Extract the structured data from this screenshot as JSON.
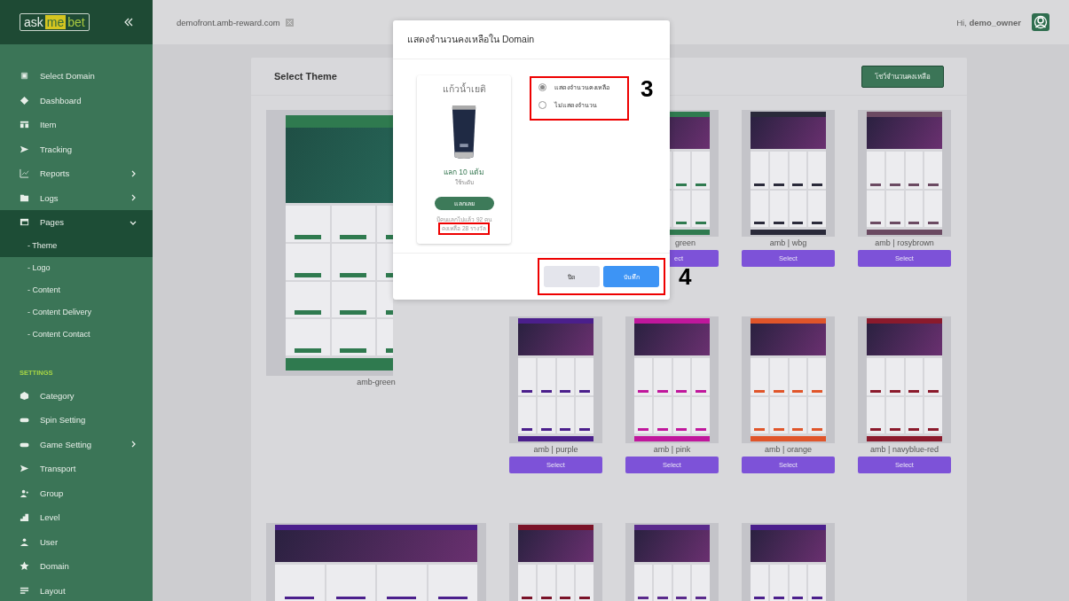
{
  "sidebar": {
    "logo": [
      "ask",
      "me",
      "bet"
    ],
    "sections": [
      {
        "items": [
          {
            "label": "Select Domain",
            "selected": false
          },
          {
            "label": "Dashboard",
            "selected": false
          },
          {
            "label": "Item",
            "selected": false
          },
          {
            "label": "Tracking",
            "selected": false
          },
          {
            "label": "Reports",
            "selected": false,
            "expanded": false
          },
          {
            "label": "Logs",
            "selected": false,
            "expanded": false
          },
          {
            "label": "Pages",
            "selected": false,
            "expanded": true,
            "children": [
              {
                "label": "- Theme",
                "selected": true
              },
              {
                "label": "- Logo",
                "selected": false
              },
              {
                "label": "- Content",
                "selected": false
              },
              {
                "label": "- Content Delivery",
                "selected": false
              },
              {
                "label": "- Content Contact",
                "selected": false
              }
            ]
          }
        ]
      },
      {
        "title": "SETTINGS",
        "items": [
          {
            "label": "Category",
            "selected": false
          },
          {
            "label": "Spin Setting",
            "selected": false
          },
          {
            "label": "Game Setting",
            "selected": false,
            "expanded": false
          },
          {
            "label": "Transport",
            "selected": false
          },
          {
            "label": "Group",
            "selected": false
          },
          {
            "label": "Level",
            "selected": false
          },
          {
            "label": "User",
            "selected": false
          },
          {
            "label": "Domain",
            "selected": false
          },
          {
            "label": "Layout",
            "selected": false
          }
        ]
      }
    ]
  },
  "topbar": {
    "domain": "demofront.amb-reward.com",
    "greeting": "Hi, **demo_owner**"
  },
  "panel": {
    "title": "Select Theme",
    "action": "โชว์จำนวนคงเหลือ",
    "themes": [
      {
        "kind": "large",
        "label": "amb-green",
        "color": "#2f7a4f"
      },
      {
        "kind": "hidden"
      },
      {
        "kind": "partial",
        "label": "green",
        "button": "ect",
        "color": "#2f7a4f"
      },
      {
        "kind": "normal",
        "label": "amb | wbg",
        "button": "Select",
        "color": "#2a2a3a"
      },
      {
        "kind": "normal",
        "label": "amb | rosybrown",
        "button": "Select",
        "color": "#6b4a62"
      },
      {
        "kind": "normal",
        "label": "amb | purple",
        "button": "Select",
        "color": "#4b1f8c"
      },
      {
        "kind": "normal",
        "label": "amb | pink",
        "button": "Select",
        "color": "#c0179c"
      },
      {
        "kind": "normal",
        "label": "amb | orange",
        "button": "Select",
        "color": "#e0552a"
      },
      {
        "kind": "normal",
        "label": "amb | navyblue-red",
        "button": "Select",
        "color": "#8b1a2c"
      },
      {
        "kind": "cut",
        "color": "#4b1f8c"
      },
      {
        "kind": "cut",
        "color": "#7a1228"
      },
      {
        "kind": "cut",
        "color": "#5a2a8c"
      },
      {
        "kind": "cut",
        "color": "#4b1f8c"
      }
    ]
  },
  "modal": {
    "title": "แสดงจำนวนคงเหลือใน Domain",
    "card": {
      "name": "แก้วน้ำเยติ",
      "points": "แลก 10 แต้ม",
      "note": "ใช้ระดับ",
      "button": "แลกเลย",
      "redeemed": "มีคนแลกไปแล้ว 92 คน",
      "stock": "คงเหลือ 28 รางวัล",
      "stock_highlighted": true
    },
    "options": [
      {
        "label": "แสดงจำนวนคงเหลือ",
        "selected": true
      },
      {
        "label": "ไม่แสดงจำนวน",
        "selected": false
      }
    ],
    "options_highlighted": true,
    "buttons": [
      {
        "label": "ปิด",
        "kind": "secondary"
      },
      {
        "label": "บันทึก",
        "kind": "primary"
      }
    ],
    "buttons_highlighted": true,
    "step_marks": [
      "3",
      "4"
    ]
  }
}
